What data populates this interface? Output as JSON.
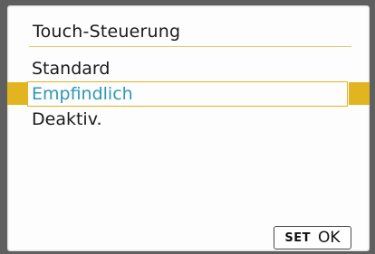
{
  "menu": {
    "title": "Touch-Steuerung",
    "options": [
      {
        "label": "Standard",
        "selected": false
      },
      {
        "label": "Empfindlich",
        "selected": true
      },
      {
        "label": "Deaktiv.",
        "selected": false
      }
    ]
  },
  "footer": {
    "set_label": "SET",
    "ok_label": "OK"
  },
  "colors": {
    "highlight": "#e2b420",
    "selected_text": "#2f97b5",
    "title_rule": "#e4c877"
  }
}
